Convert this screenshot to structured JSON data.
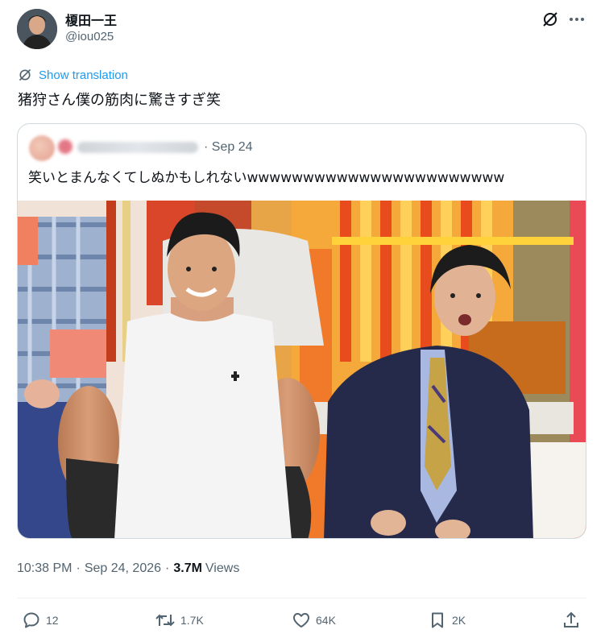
{
  "author": {
    "display_name": "榎田一王",
    "handle": "@iou025"
  },
  "translate": {
    "label": "Show translation"
  },
  "tweet": {
    "text": "猪狩さん僕の筋肉に驚きすぎ笑"
  },
  "quoted": {
    "date": "· Sep 24",
    "text": "笑いとまんなくてしぬかもしれないwwwwwwwwwwwwwwwwwwwwwww"
  },
  "meta": {
    "time": "10:38 PM",
    "date": "Sep 24, 2026",
    "views_count": "3.7M",
    "views_label": "Views"
  },
  "actions": {
    "replies": "12",
    "reposts": "1.7K",
    "likes": "64K",
    "bookmarks": "2K"
  },
  "colors": {
    "accent": "#1d9bf0",
    "text": "#0f1419",
    "secondary": "#536471",
    "border": "#cfd9de"
  },
  "icons": [
    "grok-icon",
    "more-icon",
    "translate-icon",
    "reply-icon",
    "repost-icon",
    "like-icon",
    "bookmark-icon",
    "share-icon"
  ]
}
